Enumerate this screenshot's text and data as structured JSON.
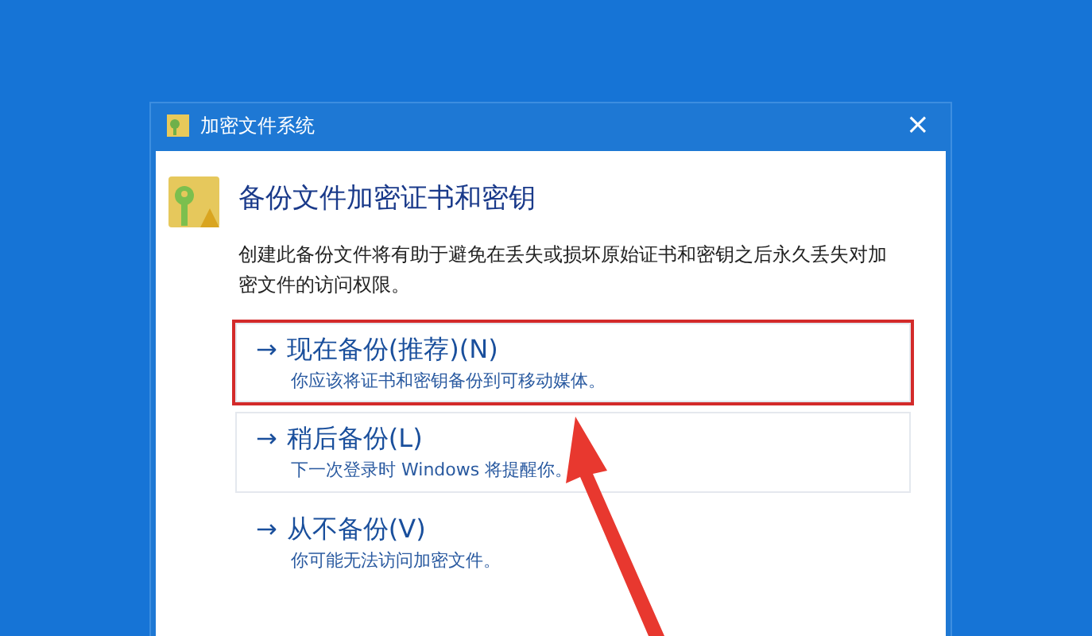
{
  "window": {
    "title": "加密文件系统",
    "close": "×"
  },
  "heading": "备份文件加密证书和密钥",
  "description": "创建此备份文件将有助于避免在丢失或损坏原始证书和密钥之后永久丢失对加密文件的访问权限。",
  "options": [
    {
      "arrow": "→",
      "label": "现在备份(推荐)(N)",
      "detail": "你应该将证书和密钥备份到可移动媒体。",
      "highlighted": true,
      "bordered": true
    },
    {
      "arrow": "→",
      "label": "稍后备份(L)",
      "detail": "下一次登录时 Windows 将提醒你。",
      "highlighted": false,
      "bordered": true
    },
    {
      "arrow": "→",
      "label": "从不备份(V)",
      "detail": "你可能无法访问加密文件。",
      "highlighted": false,
      "bordered": false
    }
  ]
}
